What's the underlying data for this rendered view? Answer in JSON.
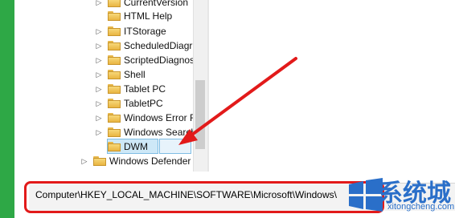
{
  "tree": {
    "items": [
      {
        "label": "CurrentVersion"
      },
      {
        "label": "HTML Help"
      },
      {
        "label": "ITStorage"
      },
      {
        "label": "ScheduledDiagr"
      },
      {
        "label": "ScriptedDiagnos"
      },
      {
        "label": "Shell"
      },
      {
        "label": "Tablet PC"
      },
      {
        "label": "TabletPC"
      },
      {
        "label": "Windows Error F"
      },
      {
        "label": "Windows Search"
      },
      {
        "label": "DWM"
      },
      {
        "label": "Windows Defender"
      }
    ]
  },
  "status_bar": {
    "path": "Computer\\HKEY_LOCAL_MACHINE\\SOFTWARE\\Microsoft\\Windows\\"
  },
  "watermark": {
    "brand": "系统城",
    "url": "xitongcheng.com"
  },
  "colors": {
    "accent_red": "#e21a1a",
    "background_green": "#2ea846",
    "folder_yellow": "#e9b542",
    "selection_blue": "#cde8f7"
  }
}
